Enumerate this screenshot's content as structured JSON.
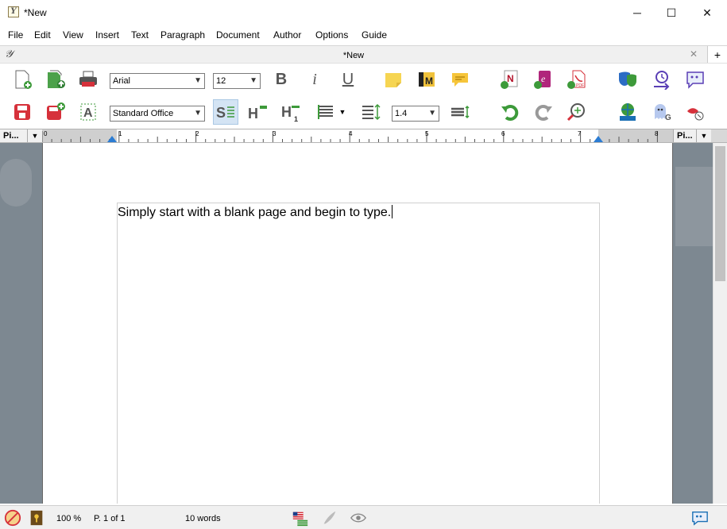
{
  "window": {
    "title": "*New",
    "minimize_glyph": "─",
    "maximize_glyph": "☐",
    "close_glyph": "✕"
  },
  "menu": [
    "File",
    "Edit",
    "View",
    "Insert",
    "Text",
    "Paragraph",
    "Document",
    "Author",
    "Options",
    "Guide"
  ],
  "doc_tab": {
    "title": "*New",
    "close_glyph": "✕",
    "add_glyph": "+"
  },
  "toolbar": {
    "font_family": "Arial",
    "font_size": "12",
    "paragraph_style": "Standard Office",
    "line_spacing": "1.4",
    "heading_plus": "H",
    "heading_one": "H",
    "heading_one_sub": "1",
    "bold": "B",
    "italic": "i",
    "underline": "U",
    "style_s": "S",
    "translate_n": "N",
    "ebook_e": "e",
    "pdf_label": "PDF",
    "magazine_m": "M",
    "accent_blue": "#1a6fb5",
    "accent_green": "#3d9a3a",
    "accent_red": "#d6313b"
  },
  "panes": {
    "left_label": "Pi...",
    "right_label": "Pi...",
    "arrow_glyph": "▼"
  },
  "ruler": {
    "numbers": [
      "0",
      "1",
      "2",
      "3",
      "4",
      "5",
      "6",
      "7",
      "8"
    ]
  },
  "document": {
    "text": "Simply start with a blank page and begin to type."
  },
  "status": {
    "zoom": "100 %",
    "page": "P. 1 of 1",
    "words": "10 words"
  }
}
